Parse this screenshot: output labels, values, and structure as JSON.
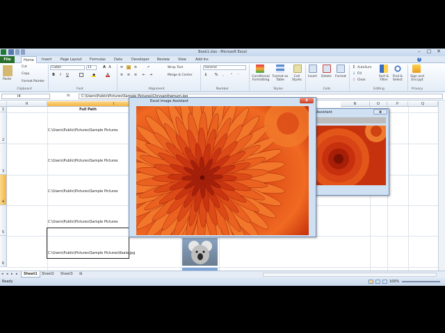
{
  "window": {
    "title": "Book1.xlsx - Microsoft Excel"
  },
  "ribbon_tabs": [
    "File",
    "Home",
    "Insert",
    "Page Layout",
    "Formulas",
    "Data",
    "Developer",
    "Review",
    "View",
    "Add-Ins"
  ],
  "clipboard": {
    "cut": "Cut",
    "copy": "Copy",
    "format_painter": "Format Painter",
    "paste": "Paste",
    "group": "Clipboard"
  },
  "font": {
    "name": "Calibri",
    "size": "11",
    "group": "Font"
  },
  "alignment": {
    "wrap_text": "Wrap Text",
    "merge_center": "Merge & Center",
    "group": "Alignment"
  },
  "number": {
    "format": "General",
    "group": "Number"
  },
  "styles": {
    "conditional": "Conditional Formatting",
    "format_table": "Format as Table",
    "cell_styles": "Cell Styles",
    "group": "Styles"
  },
  "cells": {
    "insert": "Insert",
    "delete": "Delete",
    "format": "Format",
    "group": "Cells"
  },
  "editing": {
    "autosum": "AutoSum",
    "fill": "Fill",
    "clear": "Clear",
    "sort_filter": "Sort & Filter",
    "find_select": "Find & Select",
    "group": "Editing"
  },
  "privacy": {
    "sign_encrypt": "Sign and Encrypt",
    "group": "Privacy"
  },
  "formula_bar": {
    "name_box": "I4",
    "fx": "fx",
    "value": "C:\\Users\\Public\\Pictures\\Sample Pictures\\Chrysanthemum.jpg"
  },
  "columns": [
    "H",
    "I",
    "O",
    "N",
    "O",
    "P",
    "Q"
  ],
  "rows": [
    "1",
    "2",
    "3",
    "4",
    "5",
    "6"
  ],
  "cells_data": {
    "header": "Full Path",
    "r2": "C:\\Users\\Public\\Pictures\\Sample Pictures",
    "r3": "C:\\Users\\Public\\Pictures\\Sample Pictures",
    "r4": "C:\\Users\\Public\\Pictures\\Sample Pictures",
    "r5": "C:\\Users\\Public\\Pictures\\Sample Pictures",
    "r6": "C:\\Users\\Public\\Pictures\\Sample Pictures\\Koala.jpg"
  },
  "sheet_tabs": [
    "Sheet1",
    "Sheet2",
    "Sheet3"
  ],
  "status": {
    "ready": "Ready",
    "zoom": "100%"
  },
  "dialog_main": {
    "title": "Excel  Image Assistant",
    "close": "x"
  },
  "dialog_back": {
    "title": "Assistant",
    "close": "x"
  }
}
